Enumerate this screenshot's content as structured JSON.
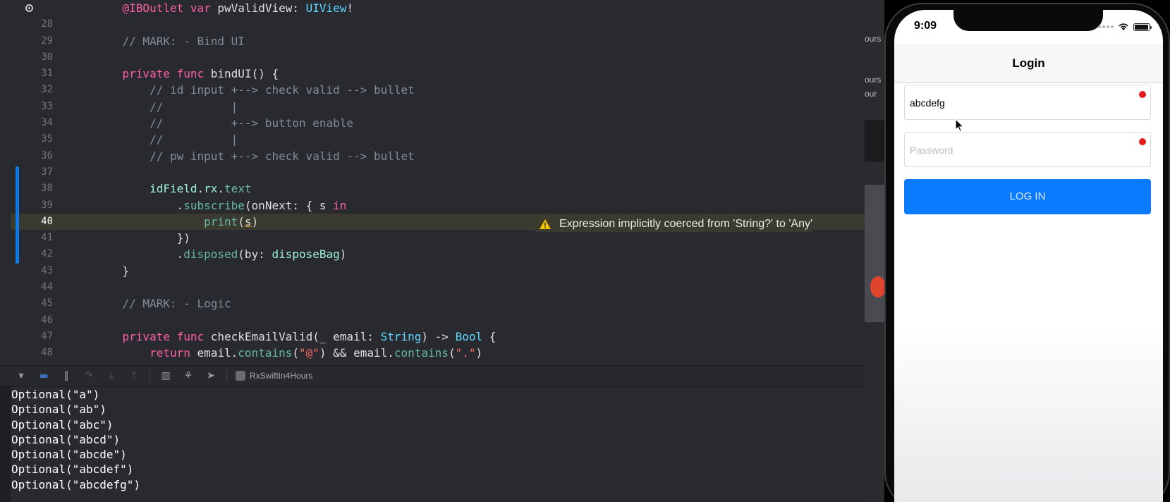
{
  "editor": {
    "lines": [
      {
        "number": "",
        "highlight": false,
        "tokens": [
          [
            "plain",
            "    "
          ],
          [
            "kw",
            "@IBOutlet"
          ],
          [
            "plain",
            " "
          ],
          [
            "kw",
            "var"
          ],
          [
            "plain",
            " pwValidView: "
          ],
          [
            "type",
            "UIView"
          ],
          [
            "plain",
            "!"
          ]
        ]
      },
      {
        "number": "28",
        "highlight": false,
        "tokens": []
      },
      {
        "number": "29",
        "highlight": false,
        "tokens": [
          [
            "comment",
            "    // MARK: - Bind UI"
          ]
        ]
      },
      {
        "number": "30",
        "highlight": false,
        "tokens": []
      },
      {
        "number": "31",
        "highlight": false,
        "tokens": [
          [
            "plain",
            "    "
          ],
          [
            "kw",
            "private"
          ],
          [
            "plain",
            " "
          ],
          [
            "kw",
            "func"
          ],
          [
            "plain",
            " bindUI() {"
          ]
        ]
      },
      {
        "number": "32",
        "highlight": false,
        "tokens": [
          [
            "comment",
            "        // id input +--> check valid --> bullet"
          ]
        ]
      },
      {
        "number": "33",
        "highlight": false,
        "tokens": [
          [
            "comment",
            "        //          |"
          ]
        ]
      },
      {
        "number": "34",
        "highlight": false,
        "tokens": [
          [
            "comment",
            "        //          +--> button enable"
          ]
        ]
      },
      {
        "number": "35",
        "highlight": false,
        "tokens": [
          [
            "comment",
            "        //          |"
          ]
        ]
      },
      {
        "number": "36",
        "highlight": false,
        "tokens": [
          [
            "comment",
            "        // pw input +--> check valid --> bullet"
          ]
        ]
      },
      {
        "number": "37",
        "highlight": false,
        "tokens": []
      },
      {
        "number": "38",
        "highlight": false,
        "tokens": [
          [
            "plain",
            "        "
          ],
          [
            "ivar",
            "idField"
          ],
          [
            "plain",
            "."
          ],
          [
            "ivar",
            "rx"
          ],
          [
            "plain",
            "."
          ],
          [
            "func",
            "text"
          ]
        ]
      },
      {
        "number": "39",
        "highlight": false,
        "tokens": [
          [
            "plain",
            "            ."
          ],
          [
            "func",
            "subscribe"
          ],
          [
            "plain",
            "(onNext: { s "
          ],
          [
            "kw",
            "in"
          ]
        ]
      },
      {
        "number": "40",
        "highlight": true,
        "tokens": [
          [
            "plain",
            "                "
          ],
          [
            "func",
            "print"
          ],
          [
            "plain",
            "("
          ],
          [
            "warnvar",
            "s"
          ],
          [
            "plain",
            ")"
          ]
        ]
      },
      {
        "number": "41",
        "highlight": false,
        "tokens": [
          [
            "plain",
            "            })"
          ]
        ]
      },
      {
        "number": "42",
        "highlight": false,
        "tokens": [
          [
            "plain",
            "            ."
          ],
          [
            "func",
            "disposed"
          ],
          [
            "plain",
            "(by: "
          ],
          [
            "ivar",
            "disposeBag"
          ],
          [
            "plain",
            ")"
          ]
        ]
      },
      {
        "number": "43",
        "highlight": false,
        "tokens": [
          [
            "plain",
            "    }"
          ]
        ]
      },
      {
        "number": "44",
        "highlight": false,
        "tokens": []
      },
      {
        "number": "45",
        "highlight": false,
        "tokens": [
          [
            "comment",
            "    // MARK: - Logic"
          ]
        ]
      },
      {
        "number": "46",
        "highlight": false,
        "tokens": []
      },
      {
        "number": "47",
        "highlight": false,
        "tokens": [
          [
            "plain",
            "    "
          ],
          [
            "kw",
            "private"
          ],
          [
            "plain",
            " "
          ],
          [
            "kw",
            "func"
          ],
          [
            "plain",
            " checkEmailValid(_ email: "
          ],
          [
            "type",
            "String"
          ],
          [
            "plain",
            ") -> "
          ],
          [
            "type",
            "Bool"
          ],
          [
            "plain",
            " {"
          ]
        ]
      },
      {
        "number": "48",
        "highlight": false,
        "tokens": [
          [
            "plain",
            "        "
          ],
          [
            "kw",
            "return"
          ],
          [
            "plain",
            " email."
          ],
          [
            "func",
            "contains"
          ],
          [
            "plain",
            "("
          ],
          [
            "string",
            "\"@\""
          ],
          [
            "plain",
            ") && email."
          ],
          [
            "func",
            "contains"
          ],
          [
            "plain",
            "("
          ],
          [
            "string",
            "\".\""
          ],
          [
            "plain",
            ")"
          ]
        ]
      }
    ],
    "warning": {
      "icon": "warning-triangle-icon",
      "text": "Expression implicitly coerced from 'String?' to 'Any'"
    }
  },
  "debug_bar": {
    "icons": [
      "hide-debug-area-icon",
      "breakpoints-toggle-icon",
      "pause-icon",
      "step-over-icon",
      "step-into-icon",
      "step-out-icon",
      "view-hierarchy-icon",
      "memory-graph-icon",
      "location-icon"
    ],
    "scheme": "RxSwiftIn4Hours"
  },
  "console": {
    "lines": [
      "Optional(\"a\")",
      "Optional(\"ab\")",
      "Optional(\"abc\")",
      "Optional(\"abcd\")",
      "Optional(\"abcde\")",
      "Optional(\"abcdef\")",
      "Optional(\"abcdefg\")"
    ]
  },
  "mid_panel": {
    "frag1": "ours",
    "frag2": "ours",
    "frag3": "our"
  },
  "simulator": {
    "time": "9:09",
    "title": "Login",
    "id_value": "abcdefg",
    "pw_placeholder": "Password",
    "login_label": "LOG IN",
    "bullet_color": "#e31b1b",
    "button_color": "#0a7bff"
  },
  "colors": {
    "editor_bg": "#292a30",
    "keyword": "#fc5fa3",
    "comment": "#7f8c98",
    "type": "#5dd8ff",
    "function": "#67b7a4",
    "string": "#fc6a5d"
  }
}
